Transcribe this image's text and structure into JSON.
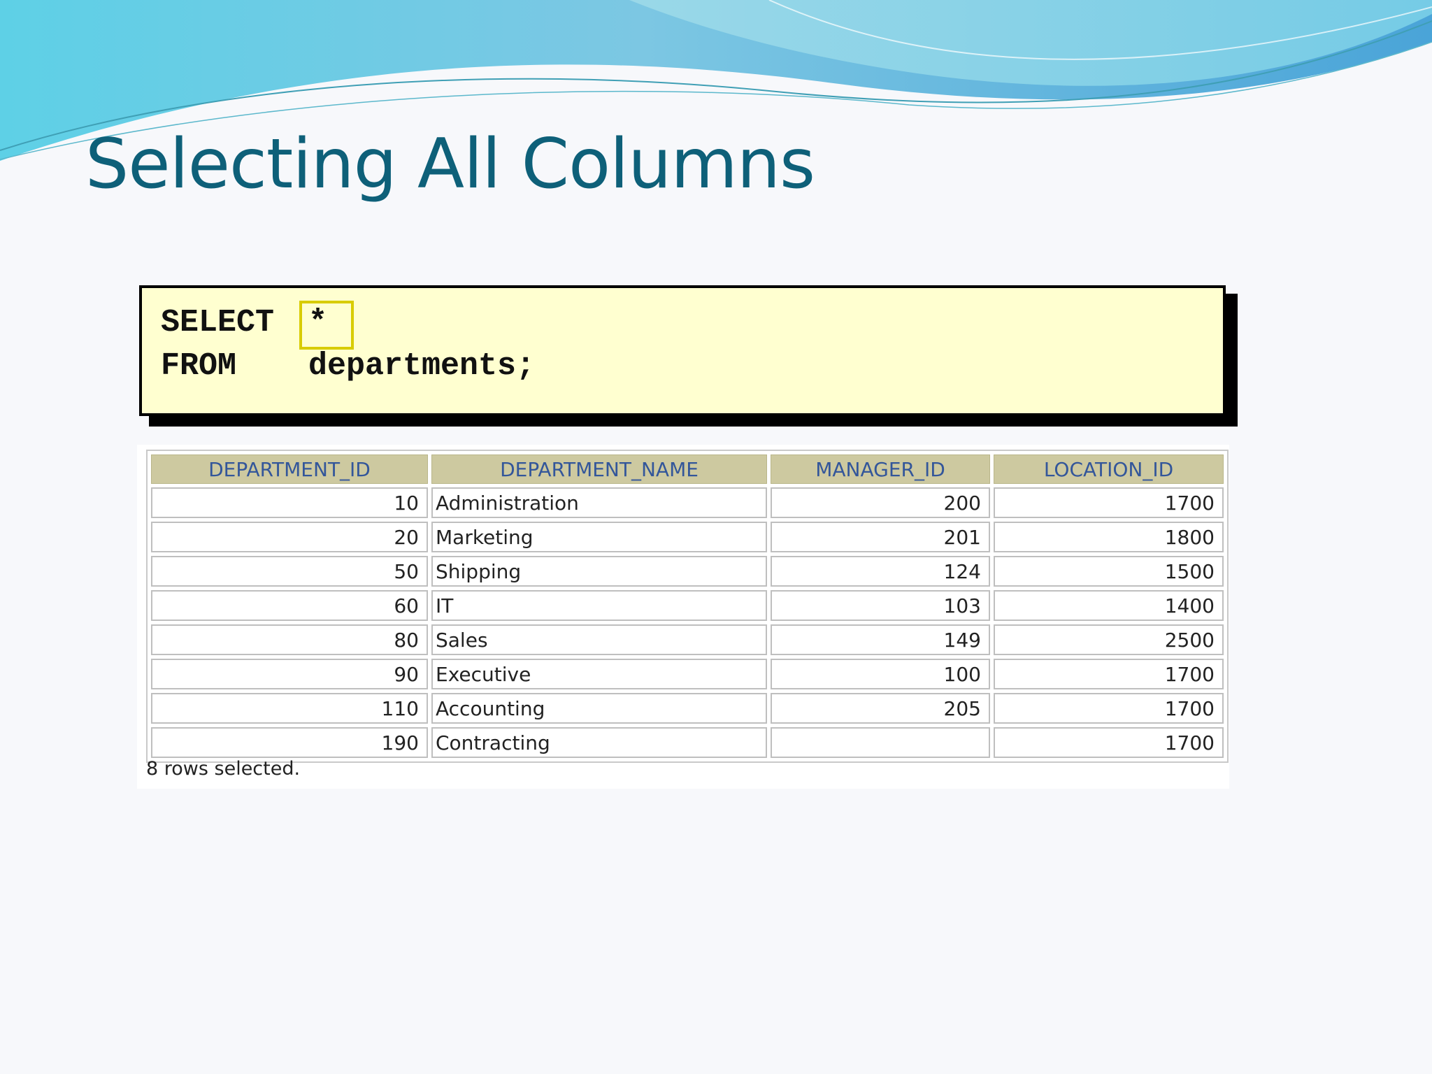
{
  "slide": {
    "title": "Selecting All Columns"
  },
  "code": {
    "line1_keyword": "SELECT",
    "line1_arg": "*",
    "line2_keyword": "FROM",
    "line2_arg": "departments;"
  },
  "table": {
    "headers": [
      "DEPARTMENT_ID",
      "DEPARTMENT_NAME",
      "MANAGER_ID",
      "LOCATION_ID"
    ],
    "rows": [
      [
        "10",
        "Administration",
        "200",
        "1700"
      ],
      [
        "20",
        "Marketing",
        "201",
        "1800"
      ],
      [
        "50",
        "Shipping",
        "124",
        "1500"
      ],
      [
        "60",
        "IT",
        "103",
        "1400"
      ],
      [
        "80",
        "Sales",
        "149",
        "2500"
      ],
      [
        "90",
        "Executive",
        "100",
        "1700"
      ],
      [
        "110",
        "Accounting",
        "205",
        "1700"
      ],
      [
        "190",
        "Contracting",
        "",
        "1700"
      ]
    ],
    "footer": "8 rows selected."
  },
  "colors": {
    "title": "#0e6079",
    "code_background": "#ffffd0",
    "highlight_border": "#d8cc00",
    "header_background": "#cdc9a0",
    "header_text": "#33569a"
  }
}
